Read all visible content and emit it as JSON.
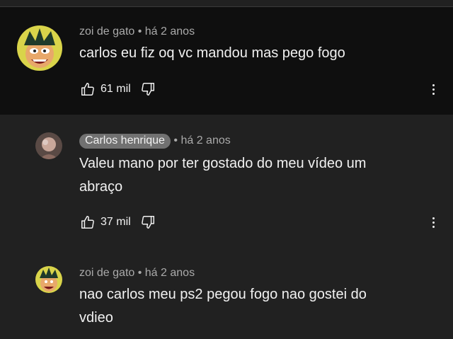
{
  "comment": {
    "author": "zoi de gato",
    "time": "• há 2 anos",
    "text": "carlos eu fiz oq vc mandou mas pego fogo",
    "likes": "61 mil"
  },
  "replies": [
    {
      "author": "Carlos henrique",
      "time": "• há 2 anos",
      "text_line1": "Valeu mano por ter gostado do meu vídeo um",
      "text_line2": "abraço",
      "likes": "37 mil"
    },
    {
      "author": "zoi de gato",
      "time": "• há 2 anos",
      "text_line1": "nao carlos meu ps2 pegou fogo nao gostei do",
      "text_line2": "vdieo"
    }
  ],
  "icons": [
    "like-icon",
    "dislike-icon",
    "more-options-icon",
    "avatar"
  ]
}
